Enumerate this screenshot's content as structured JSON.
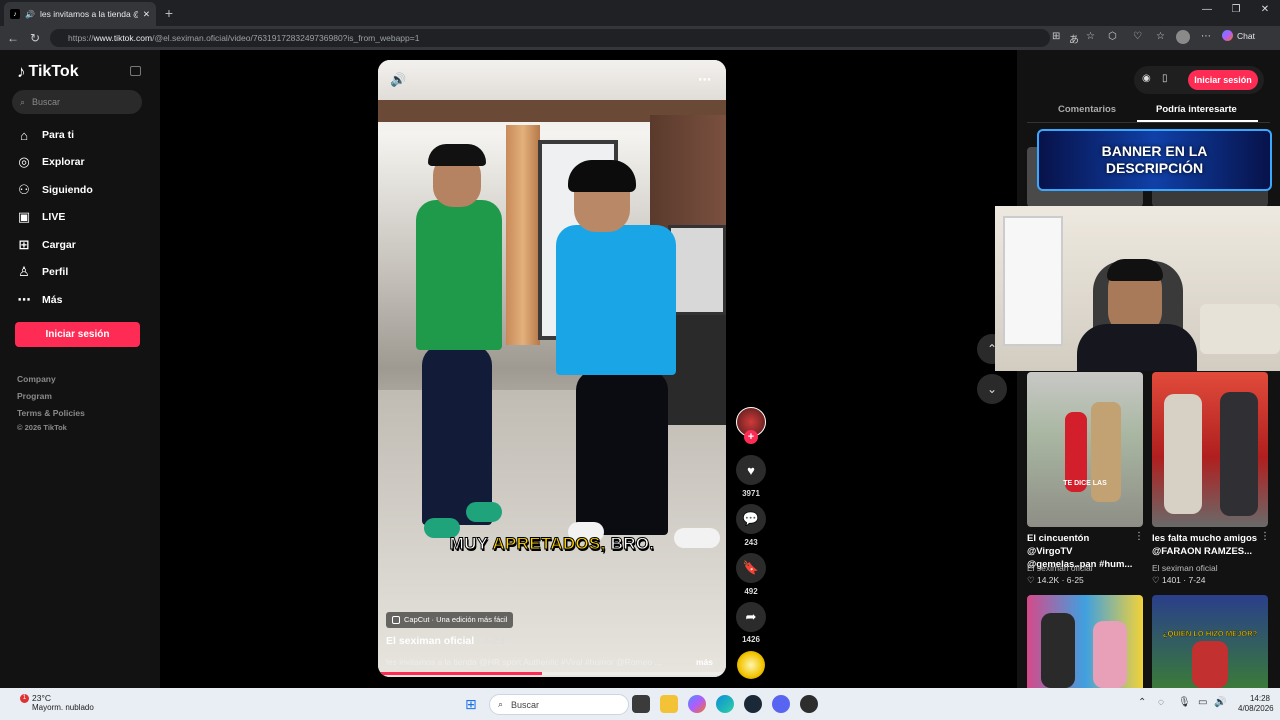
{
  "browser": {
    "tab_title": "les invitamos a la tienda @HR",
    "url_prefix": "https://",
    "url_host": "www.tiktok.com",
    "url_path": "/@el.seximan.oficial/video/7631917283249736980?is_from_webapp=1",
    "chat_label": "Chat"
  },
  "sidebar": {
    "brand": "TikTok",
    "search_placeholder": "Buscar",
    "items": [
      {
        "label": "Para ti",
        "icon": "home-icon"
      },
      {
        "label": "Explorar",
        "icon": "compass-icon"
      },
      {
        "label": "Siguiendo",
        "icon": "following-icon"
      },
      {
        "label": "LIVE",
        "icon": "live-icon"
      },
      {
        "label": "Cargar",
        "icon": "upload-icon"
      },
      {
        "label": "Perfil",
        "icon": "profile-icon"
      },
      {
        "label": "Más",
        "icon": "more-icon"
      }
    ],
    "login_label": "Iniciar sesión",
    "footer": [
      "Company",
      "Program",
      "Terms & Policies",
      "© 2026 TikTok"
    ]
  },
  "video": {
    "caption_pre": "MUY ",
    "caption_highlight": "APRETADOS,",
    "caption_post": " BRO.",
    "capcut_label": "CapCut · Una edición más fácil",
    "author": "El seximan oficial",
    "date": " · 4-23",
    "description": "les invitamos a la tienda @HR sport Authentic #Viral #humor @Romeo ...",
    "more_label": "más",
    "progress": 0.47
  },
  "actions": {
    "likes": "3971",
    "comments": "243",
    "saves": "492",
    "shares": "1426"
  },
  "right_panel": {
    "login_label": "Iniciar sesión",
    "tabs": [
      "Comentarios",
      "Podría interesarte"
    ],
    "active_tab": "Podría interesarte",
    "banner_line1": "BANNER EN LA",
    "banner_line2": "DESCRIPCIÓN",
    "videos": [
      {
        "title": "El cincuentón @VirgoTV @gemelas..pan #hum...",
        "author": "El seximan oficial",
        "likes": "14.2K",
        "date": "6-25",
        "overlay": "TE DICE LAS"
      },
      {
        "title": "les falta mucho amigos @FARAON RAMZES...",
        "author": "El seximan oficial",
        "likes": "1401",
        "date": "7-24",
        "overlay": ""
      },
      {
        "title": "",
        "author": "",
        "likes": "",
        "date": "",
        "overlay": ""
      },
      {
        "title": "",
        "author": "",
        "likes": "",
        "date": "",
        "overlay": "¿QUIEN LO HIZO MEJOR?"
      }
    ]
  },
  "taskbar": {
    "weather_temp": "23°C",
    "weather_desc": "Mayorm. nublado",
    "search_placeholder": "Buscar",
    "time": "14:28",
    "date": "4/08/2026"
  },
  "colors": {
    "accent": "#fe2c55",
    "sidebar_bg": "#121212",
    "taskbar_bg": "#e9eef5"
  }
}
